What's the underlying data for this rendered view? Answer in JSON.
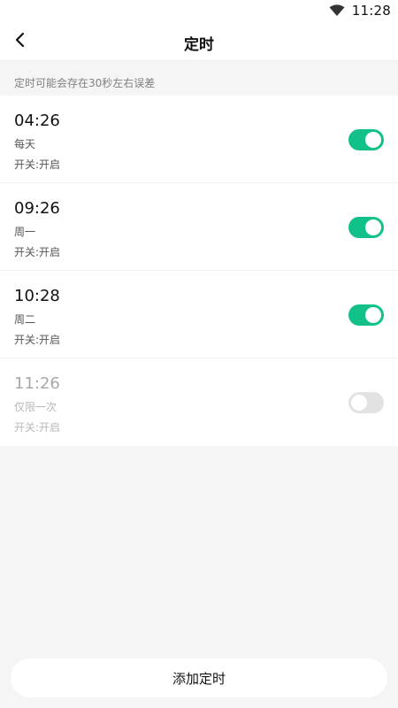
{
  "status_bar": {
    "time": "11:28",
    "wifi_icon": "wifi-icon"
  },
  "header": {
    "title": "定时",
    "back_icon": "chevron-left-icon"
  },
  "notice": {
    "text": "定时可能会存在30秒左右误差"
  },
  "timers": [
    {
      "time": "04:26",
      "repeat": "每天",
      "status": "开关:开启",
      "enabled": true
    },
    {
      "time": "09:26",
      "repeat": "周一",
      "status": "开关:开启",
      "enabled": true
    },
    {
      "time": "10:28",
      "repeat": "周二",
      "status": "开关:开启",
      "enabled": true
    },
    {
      "time": "11:26",
      "repeat": "仅限一次",
      "status": "开关:开启",
      "enabled": false
    }
  ],
  "footer": {
    "add_label": "添加定时"
  },
  "colors": {
    "accent": "#12c08a",
    "toggle_off": "#e2e2e2",
    "background": "#f5f5f5"
  }
}
